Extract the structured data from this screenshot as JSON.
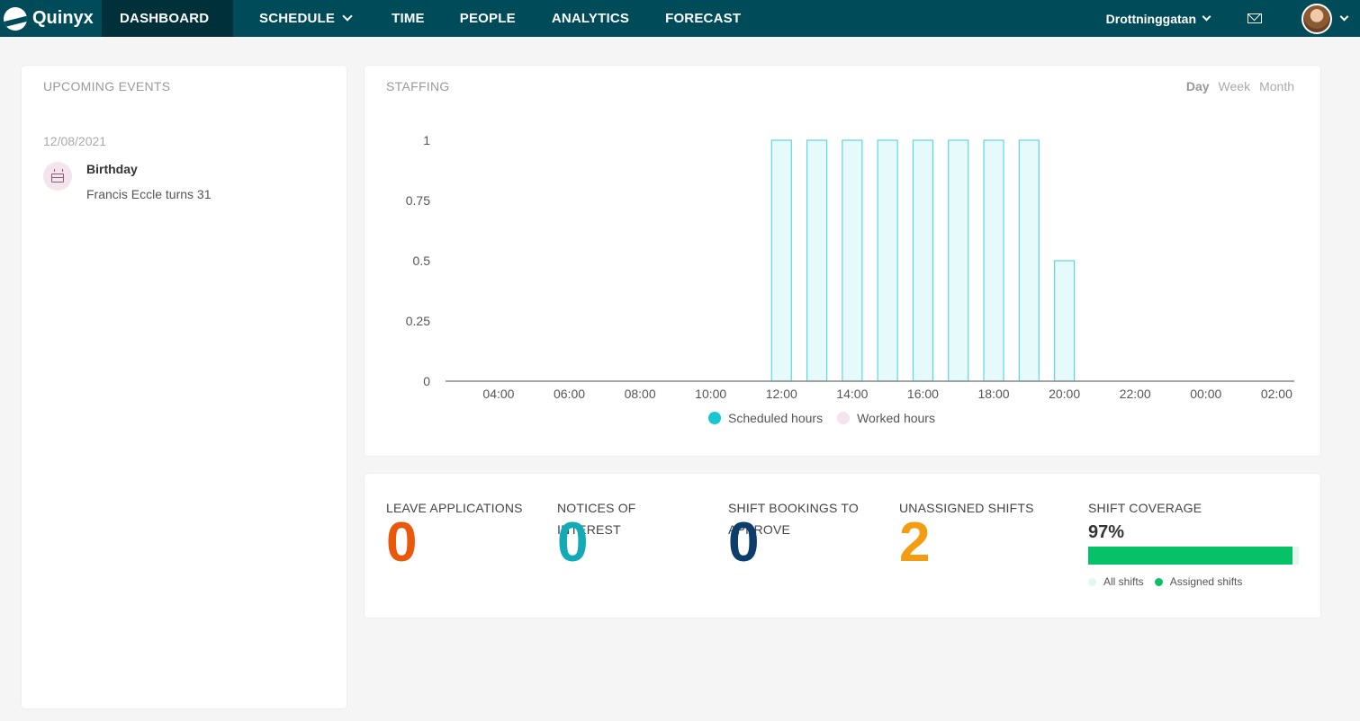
{
  "nav": {
    "logo": "Quinyx",
    "items": [
      {
        "label": "DASHBOARD"
      },
      {
        "label": "SCHEDULE"
      },
      {
        "label": "TIME"
      },
      {
        "label": "PEOPLE"
      },
      {
        "label": "ANALYTICS"
      },
      {
        "label": "FORECAST"
      }
    ],
    "location": "Drottninggatan",
    "icons": [
      "mail-icon",
      "avatar",
      "chevron-down-icon"
    ]
  },
  "events": {
    "title": "UPCOMING EVENTS",
    "date": "12/08/2021",
    "items": [
      {
        "icon": "cake-icon",
        "name": "Birthday",
        "desc": "Francis Eccle turns 31"
      }
    ]
  },
  "staffing": {
    "title": "STAFFING",
    "periods": [
      "Day",
      "Week",
      "Month"
    ],
    "legend": [
      {
        "label": "Scheduled hours",
        "color": "#16c7d1"
      },
      {
        "label": "Worked hours",
        "color": "#f3e4ee"
      }
    ]
  },
  "chart_data": {
    "type": "bar",
    "categories": [
      "03:00",
      "04:00",
      "05:00",
      "06:00",
      "07:00",
      "08:00",
      "09:00",
      "10:00",
      "11:00",
      "12:00",
      "13:00",
      "14:00",
      "15:00",
      "16:00",
      "17:00",
      "18:00",
      "19:00",
      "20:00",
      "21:00",
      "22:00",
      "23:00",
      "00:00",
      "01:00",
      "02:00"
    ],
    "x_tick_labels": [
      "04:00",
      "06:00",
      "08:00",
      "10:00",
      "12:00",
      "14:00",
      "16:00",
      "18:00",
      "20:00",
      "22:00",
      "00:00",
      "02:00"
    ],
    "series": [
      {
        "name": "Scheduled hours",
        "values": [
          0,
          0,
          0,
          0,
          0,
          0,
          0,
          0,
          0,
          1,
          1,
          1,
          1,
          1,
          1,
          1,
          1,
          0.5,
          0,
          0,
          0,
          0,
          0,
          0
        ]
      },
      {
        "name": "Worked hours",
        "values": [
          0,
          0,
          0,
          0,
          0,
          0,
          0,
          0,
          0,
          0,
          0,
          0,
          0,
          0,
          0,
          0,
          0,
          0,
          0,
          0,
          0,
          0,
          0,
          0
        ]
      }
    ],
    "y_ticks": [
      "1",
      "0.75",
      "0.5",
      "0.25",
      "0"
    ],
    "ylim": [
      0,
      1
    ],
    "bar_fill": "#e6fafb",
    "bar_stroke": "#5ed6dd",
    "axis_color": "#888888",
    "grid": false,
    "legend_position": "bottom"
  },
  "stats": {
    "items": [
      {
        "label": "LEAVE APPLICATIONS",
        "value": "0",
        "color": "#e8590c"
      },
      {
        "label": "NOTICES OF INTEREST",
        "value": "0",
        "color": "#12aab6"
      },
      {
        "label": "SHIFT BOOKINGS TO APPROVE",
        "value": "0",
        "color": "#0d3d6b"
      },
      {
        "label": "UNASSIGNED SHIFTS",
        "value": "2",
        "color": "#f29d12"
      }
    ],
    "coverage": {
      "label": "SHIFT COVERAGE",
      "percent_text": "97%",
      "fraction": 0.97,
      "legend_all": "All shifts",
      "legend_assigned": "Assigned shifts",
      "color_all": "#e4f7ee",
      "color_assigned": "#06c167"
    }
  }
}
